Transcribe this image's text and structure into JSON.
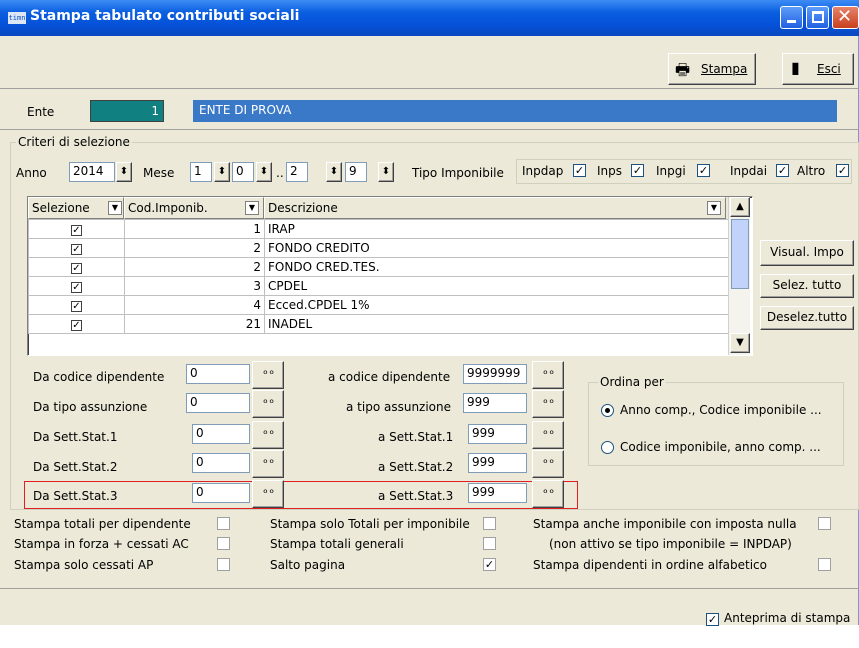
{
  "window": {
    "title": "Stampa tabulato contributi sociali",
    "icon_label": "timn"
  },
  "toolbar": {
    "stampa_label": "Stampa",
    "esci_label": "Esci"
  },
  "ente": {
    "label": "Ente",
    "code": "1",
    "name": "ENTE DI PROVA"
  },
  "criteri": {
    "group_label": "Criteri di selezione",
    "anno_label": "Anno",
    "anno_value": "2014",
    "mese_label": "Mese",
    "mese_from": "1",
    "mese_from2": "0",
    "range_sep": "..",
    "mese_to": "2",
    "mese_to2": "9",
    "tipo_imponibile_label": "Tipo Imponibile",
    "types": [
      {
        "label": "Inpdap",
        "checked": true
      },
      {
        "label": "Inps",
        "checked": true
      },
      {
        "label": "Inpgi",
        "checked": true
      },
      {
        "label": "Inpdai",
        "checked": true
      },
      {
        "label": "Altro",
        "checked": true
      }
    ]
  },
  "grid": {
    "columns": [
      "Selezione",
      "Cod.Imponib.",
      "Descrizione"
    ],
    "rows": [
      {
        "selected": true,
        "code": "1",
        "desc": "IRAP"
      },
      {
        "selected": true,
        "code": "2",
        "desc": "FONDO CREDITO"
      },
      {
        "selected": true,
        "code": "2",
        "desc": "FONDO CRED.TES."
      },
      {
        "selected": true,
        "code": "3",
        "desc": "CPDEL"
      },
      {
        "selected": true,
        "code": "4",
        "desc": "Ecced.CPDEL 1%"
      },
      {
        "selected": true,
        "code": "21",
        "desc": "INADEL"
      }
    ]
  },
  "side_buttons": {
    "visual_impo": "Visual. Impo",
    "selez_tutto": "Selez. tutto",
    "deselez_tutto": "Deselez.tutto"
  },
  "ranges": {
    "da_codice_dip_label": "Da codice dipendente",
    "da_codice_dip": "0",
    "a_codice_dip_label": "a codice dipendente",
    "a_codice_dip": "9999999",
    "da_tipo_ass_label": "Da tipo assunzione",
    "da_tipo_ass": "0",
    "a_tipo_ass_label": "a tipo assunzione",
    "a_tipo_ass": "999",
    "da_sett1_label": "Da Sett.Stat.1",
    "da_sett1": "0",
    "a_sett1_label": "a Sett.Stat.1",
    "a_sett1": "999",
    "da_sett2_label": "Da Sett.Stat.2",
    "da_sett2": "0",
    "a_sett2_label": "a Sett.Stat.2",
    "a_sett2": "999",
    "da_sett3_label": "Da Sett.Stat.3",
    "da_sett3": "0",
    "a_sett3_label": "a Sett.Stat.3",
    "a_sett3": "999"
  },
  "ordina": {
    "group_label": "Ordina per",
    "opt1": "Anno comp., Codice imponibile ...",
    "opt2": "Codice imponibile, anno comp. ..."
  },
  "options": {
    "totali_dip": "Stampa totali per dipendente",
    "forza_cessati": "Stampa in forza + cessati AC",
    "solo_cessati": "Stampa solo cessati AP",
    "solo_totali_imp": "Stampa solo Totali per imponibile",
    "totali_generali": "Stampa totali generali",
    "salto_pagina": "Salto pagina",
    "anche_nulla": "Stampa anche imponibile con imposta nulla",
    "nota_inpdap": "(non attivo se tipo imponibile  = INPDAP)",
    "ordine_alfabetico": "Stampa dipendenti in ordine alfabetico",
    "salto_pagina_checked": true
  },
  "footer": {
    "anteprima_label": "Anteprima di stampa",
    "anteprima_checked": true
  }
}
